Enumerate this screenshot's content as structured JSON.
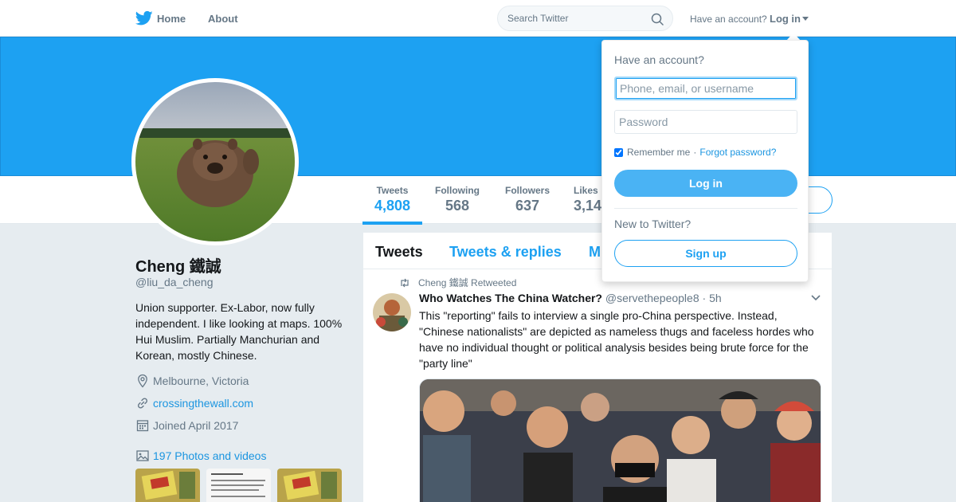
{
  "colors": {
    "brand": "#1da1f2",
    "banner": "#1da1f2",
    "link": "#1b95e0",
    "muted": "#657786",
    "background": "#e6ecf0"
  },
  "nav": {
    "logo_icon": "twitter-bird-icon",
    "home": "Home",
    "about": "About",
    "search_placeholder": "Search Twitter",
    "have_account": "Have an account?",
    "login": "Log in"
  },
  "profile": {
    "name": "Cheng 鐵誠",
    "handle": "@liu_da_cheng",
    "bio": "Union supporter. Ex-Labor, now fully independent. I like looking at maps. 100% Hui Muslim. Partially Manchurian and Korean, mostly Chinese.",
    "location": "Melbourne, Victoria",
    "website": "crossingthewall.com",
    "joined": "Joined April 2017",
    "photos": "197 Photos and videos"
  },
  "stats": [
    {
      "label": "Tweets",
      "value": "4,808"
    },
    {
      "label": "Following",
      "value": "568"
    },
    {
      "label": "Followers",
      "value": "637"
    },
    {
      "label": "Likes",
      "value": "3,14"
    }
  ],
  "tabs": [
    "Tweets",
    "Tweets & replies",
    "M"
  ],
  "tweet": {
    "retweet_note": "Cheng 鐵誠 Retweeted",
    "author": "Who Watches The China Watcher?",
    "handle": "@servethepeople8",
    "dot": "·",
    "time": "5h",
    "text": "This \"reporting\" fails to interview a single pro-China perspective. Instead, \"Chinese nationalists\" are depicted as nameless thugs and faceless hordes who have no individual thought or political analysis besides being brute force for the \"party line\""
  },
  "login_dropdown": {
    "title": "Have an account?",
    "username_placeholder": "Phone, email, or username",
    "password_placeholder": "Password",
    "remember": "Remember me",
    "separator": "·",
    "forgot": "Forgot password?",
    "login_button": "Log in",
    "new_to": "New to Twitter?",
    "signup_button": "Sign up"
  }
}
